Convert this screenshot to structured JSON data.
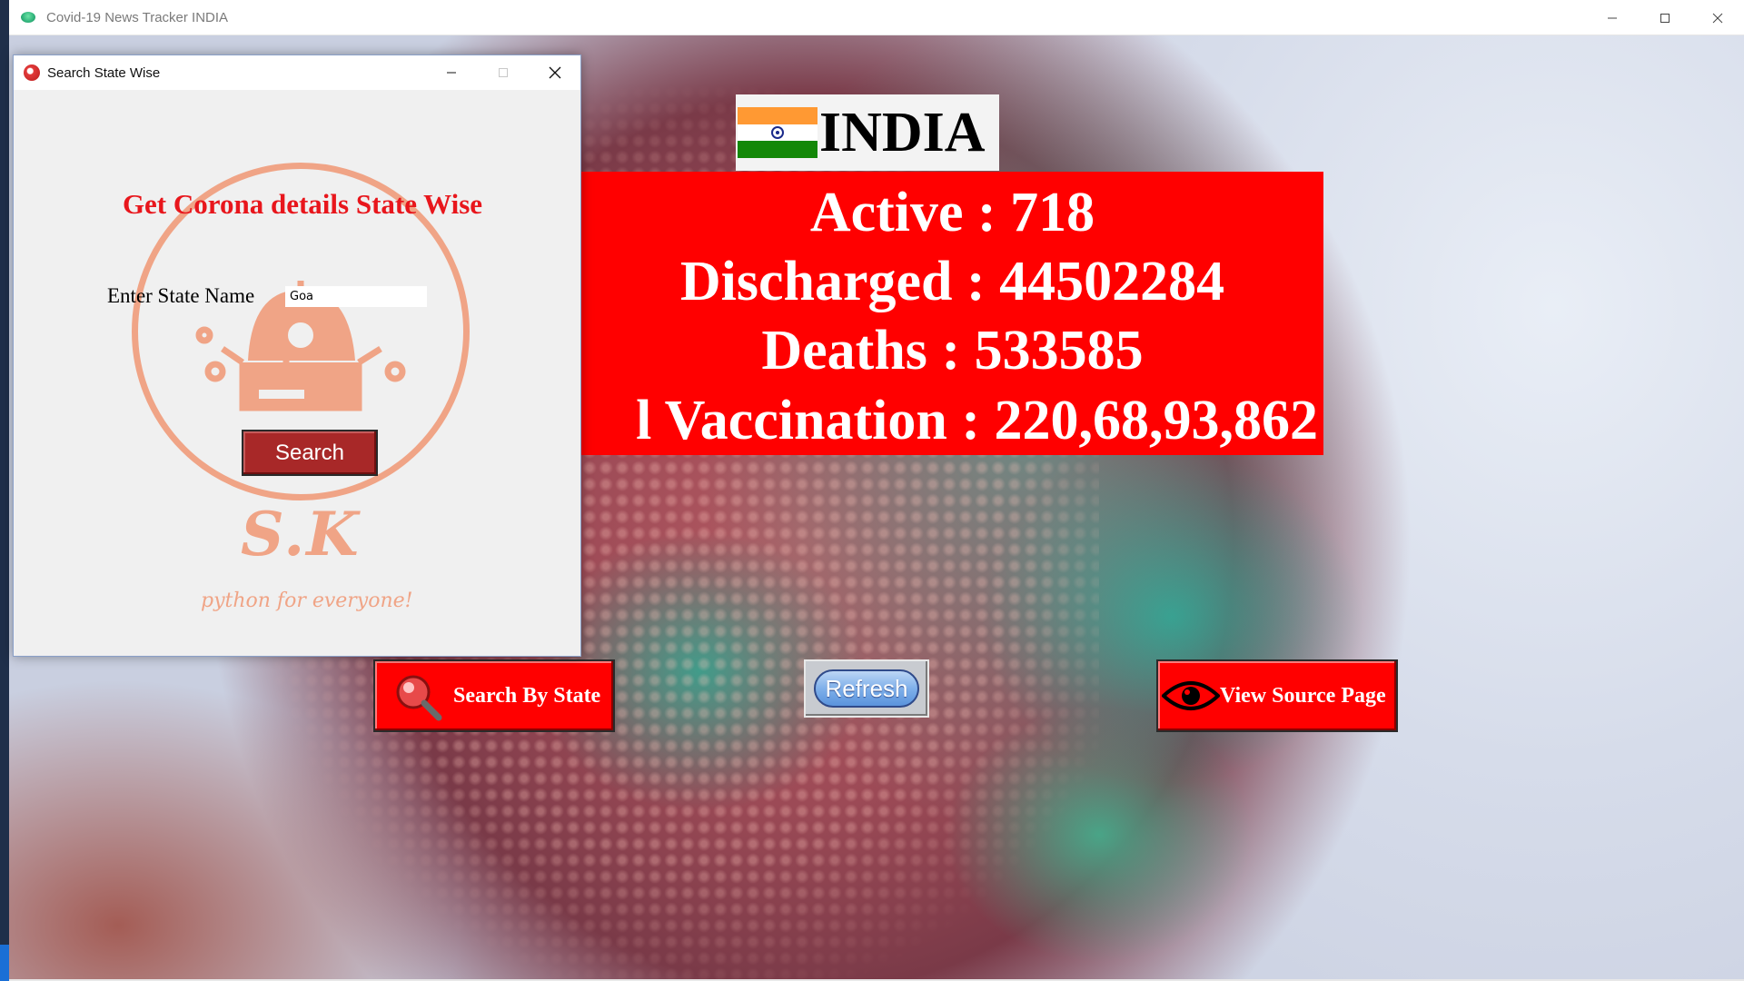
{
  "main_window": {
    "title": "Covid-19 News Tracker INDIA",
    "controls": [
      "minimize-icon",
      "maximize-icon",
      "close-icon"
    ]
  },
  "header": {
    "country": "INDIA",
    "flag_colors": [
      "#ff9933",
      "#ffffff",
      "#138808"
    ]
  },
  "stats": {
    "active": "Active : 718",
    "discharged": "Discharged : 44502284",
    "deaths": "Deaths : 533585",
    "vaccination": "l Vaccination : 220,68,93,862"
  },
  "buttons": {
    "search_by_state": "Search By State",
    "refresh": "Refresh",
    "view_source": "View Source Page"
  },
  "dialog": {
    "title": "Search State Wise",
    "heading": "Get Corona details State Wise",
    "state_label": "Enter State Name",
    "state_value": "Goa",
    "search_button": "Search",
    "logo_text": "S.K",
    "tagline": "python for everyone!"
  },
  "colors": {
    "stats_bg": "#ff0000",
    "heading_red": "#e8161c",
    "logo_peach": "#f0a486",
    "search_btn": "#a82828"
  }
}
